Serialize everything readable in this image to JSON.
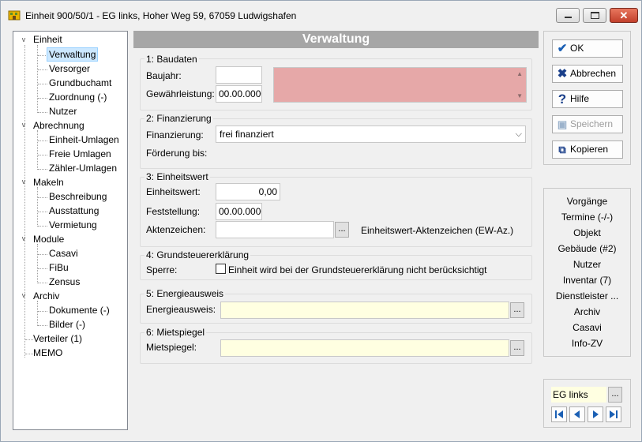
{
  "window": {
    "title": "Einheit 900/50/1 - EG links, Hoher Weg 59, 67059 Ludwigshafen"
  },
  "tree": {
    "items": [
      {
        "label": "Einheit",
        "expander": "v"
      },
      {
        "label": "Verwaltung",
        "selected": true
      },
      {
        "label": "Versorger"
      },
      {
        "label": "Grundbuchamt"
      },
      {
        "label": "Zuordnung (-)"
      },
      {
        "label": "Nutzer"
      },
      {
        "label": "Abrechnung",
        "expander": "v"
      },
      {
        "label": "Einheit-Umlagen"
      },
      {
        "label": "Freie Umlagen"
      },
      {
        "label": "Zähler-Umlagen"
      },
      {
        "label": "Makeln",
        "expander": "v"
      },
      {
        "label": "Beschreibung"
      },
      {
        "label": "Ausstattung"
      },
      {
        "label": "Vermietung"
      },
      {
        "label": "Module",
        "expander": "v"
      },
      {
        "label": "Casavi"
      },
      {
        "label": "FiBu"
      },
      {
        "label": "Zensus"
      },
      {
        "label": "Archiv",
        "expander": "v"
      },
      {
        "label": "Dokumente (-)"
      },
      {
        "label": "Bilder (-)"
      },
      {
        "label": "Verteiler (1)"
      },
      {
        "label": "MEMO"
      }
    ]
  },
  "main": {
    "header": "Verwaltung",
    "baudaten": {
      "title": "1: Baudaten",
      "baujahr_label": "Baujahr:",
      "baujahr_value": "",
      "gewaehr_label": "Gewährleistung:",
      "gewaehr_value": "00.00.0000"
    },
    "finanzierung": {
      "title": "2: Finanzierung",
      "fin_label": "Finanzierung:",
      "fin_value": "frei finanziert",
      "foerderung_label": "Förderung bis:"
    },
    "einheitswert": {
      "title": "3: Einheitswert",
      "ew_label": "Einheitswert:",
      "ew_value": "0,00",
      "fest_label": "Feststellung:",
      "fest_value": "00.00.0000",
      "az_label": "Aktenzeichen:",
      "az_value": "",
      "az_button": "...",
      "az_hint": "Einheitswert-Aktenzeichen (EW-Az.)"
    },
    "grundsteuer": {
      "title": "4: Grundsteuererklärung",
      "sperre_label": "Sperre:",
      "sperre_checkbox": "Einheit wird bei der Grundsteuererklärung nicht berücksichtigt",
      "sperre_checked": false
    },
    "energie": {
      "title": "5: Energieausweis",
      "label": "Energieausweis:",
      "value": "",
      "button": "..."
    },
    "miet": {
      "title": "6: Mietspiegel",
      "label": "Mietspiegel:",
      "value": "",
      "button": "..."
    }
  },
  "actions": {
    "ok": "OK",
    "abbrechen": "Abbrechen",
    "hilfe": "Hilfe",
    "speichern": "Speichern",
    "kopieren": "Kopieren"
  },
  "nav": {
    "items": [
      "Vorgänge",
      "Termine (-/-)",
      "Objekt",
      "Gebäude (#2)",
      "Nutzer",
      "Inventar (7)",
      "Dienstleister ...",
      "Archiv",
      "Casavi",
      "Info-ZV"
    ]
  },
  "record": {
    "name": "EG links",
    "button": "..."
  },
  "colors": {
    "header_bg": "#a6a6a6",
    "selection": "#cce8ff",
    "pink_field": "#e6a8a8",
    "yellow_field": "#ffffe1",
    "accent_blue": "#1a5fb4"
  }
}
